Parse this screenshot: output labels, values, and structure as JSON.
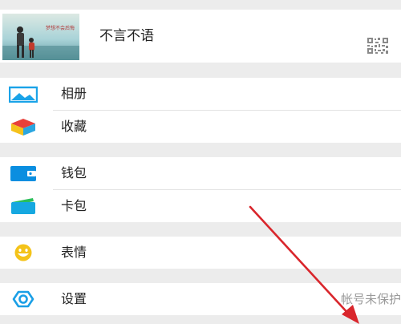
{
  "profile": {
    "nickname": "不言不语",
    "avatar_caption": "梦想不会后悔",
    "qr_icon": "qr-code-icon"
  },
  "menu": {
    "album": {
      "label": "相册",
      "icon": "album-icon"
    },
    "favorites": {
      "label": "收藏",
      "icon": "favorites-cube-icon"
    },
    "wallet": {
      "label": "钱包",
      "icon": "wallet-icon"
    },
    "cards": {
      "label": "卡包",
      "icon": "card-wallet-icon"
    },
    "stickers": {
      "label": "表情",
      "icon": "smiley-icon"
    },
    "settings": {
      "label": "设置",
      "icon": "gear-icon",
      "status": "帐号未保护"
    }
  },
  "colors": {
    "album_icon": "#1aa3e8",
    "wallet_icon": "#0a8ee0",
    "card_icon": "#16a8e0",
    "sticker_icon": "#f4c319",
    "settings_icon": "#1a9fe6",
    "annotation_arrow": "#d9262c"
  }
}
